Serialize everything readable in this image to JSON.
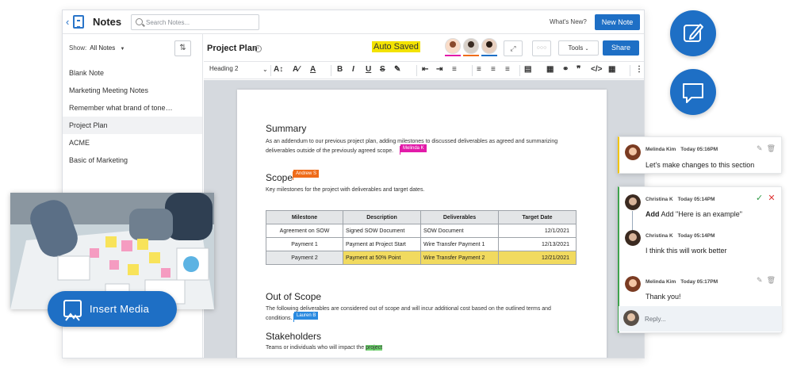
{
  "header": {
    "app_title": "Notes",
    "search_placeholder": "Search Notes...",
    "whats_new": "What's New?",
    "new_note": "New Note"
  },
  "sidebar": {
    "show_label": "Show:",
    "show_value": "All Notes",
    "notes": [
      {
        "label": "Blank Note"
      },
      {
        "label": "Marketing Meeting Notes"
      },
      {
        "label": "Remember what brand of tone…"
      },
      {
        "label": "Project Plan"
      },
      {
        "label": "ACME"
      },
      {
        "label": "Basic of Marketing"
      }
    ]
  },
  "editor": {
    "title": "Project Plan",
    "status": "Auto Saved",
    "tools": "Tools",
    "share": "Share",
    "heading_style": "Heading 2",
    "collaborator_colors": [
      "#e21ba9",
      "#ef6c1a",
      "#1e6fc5"
    ]
  },
  "document": {
    "summary_heading": "Summary",
    "summary_text_1": "As an addendum to our previous project plan, adding milestones to discussed deliverables as agreed and summarizing",
    "summary_text_2": "deliverables outside of the previously agreed scope.",
    "tag_melinda": "Melinda K",
    "scope_heading": "Scope",
    "tag_andrew": "Andrew S",
    "scope_text": "Key milestones for the project with deliverables and target dates.",
    "table": {
      "headers": [
        "Milestone",
        "Description",
        "Deliverables",
        "Target Date"
      ],
      "rows": [
        [
          "Agreement on SOW",
          "Signed SOW Document",
          "SOW Document",
          "12/1/2021"
        ],
        [
          "Payment 1",
          "Payment at Project Start",
          "Wire Transfer Payment 1",
          "12/13/2021"
        ],
        [
          "Payment 2",
          "Payment at 50% Point",
          "Wire Transfer Payment 2",
          "12/21/2021"
        ]
      ]
    },
    "oos_heading": "Out of Scope",
    "oos_text_1": "The following deliverables are considered out of scope and will incur additional cost based on the outlined terms and",
    "oos_text_2": "conditions.",
    "tag_lauren": "Lauren B",
    "stake_heading": "Stakeholders",
    "stake_text": "Teams or individuals who will impact the",
    "stake_highlight": "project"
  },
  "media": {
    "insert_label": "Insert Media"
  },
  "comments": [
    {
      "name": "Melinda Kim",
      "time": "Today 05:16PM",
      "text": "Let's make changes to this section"
    },
    {
      "name": "Christina K",
      "time": "Today 05:14PM",
      "text": "Add \"Here is an example\""
    },
    {
      "name": "Christina K",
      "time": "Today 05:14PM",
      "text": "I think this will work better"
    },
    {
      "name": "Melinda Kim",
      "time": "Today 05:17PM",
      "text": "Thank you!"
    }
  ],
  "reply_placeholder": "Reply..."
}
